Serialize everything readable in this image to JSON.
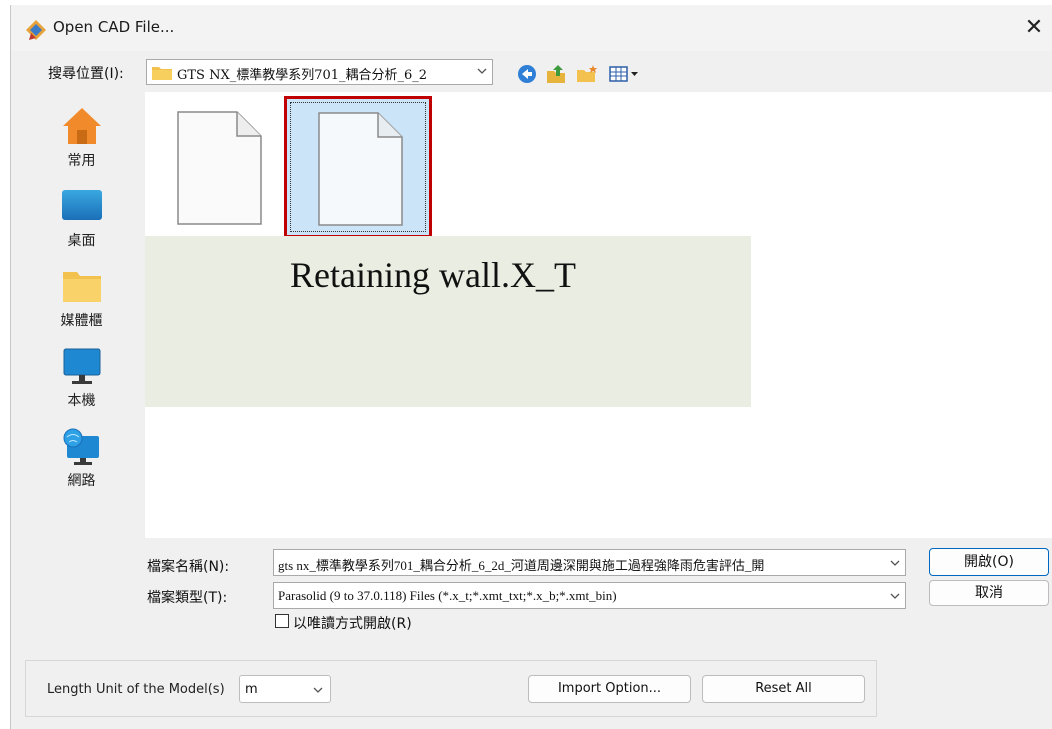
{
  "window": {
    "title": "Open CAD File...",
    "close_glyph": "✕"
  },
  "toolbar": {
    "look_in_label": "搜尋位置(I):",
    "look_in_value": "GTS NX_標準教學系列701_耦合分析_6_2",
    "icons": [
      "back-icon",
      "up-folder-icon",
      "new-folder-icon",
      "view-menu-icon"
    ]
  },
  "places": [
    {
      "label": "常用",
      "icon": "home-icon"
    },
    {
      "label": "桌面",
      "icon": "desktop-icon"
    },
    {
      "label": "媒體櫃",
      "icon": "library-folder-icon"
    },
    {
      "label": "本機",
      "icon": "computer-icon"
    },
    {
      "label": "網路",
      "icon": "network-icon"
    }
  ],
  "files": {
    "overlay_caption": "Retaining wall.X_T"
  },
  "form": {
    "filename_label": "檔案名稱(N):",
    "filename_value": "gts nx_標準教學系列701_耦合分析_6_2d_河道周邊深開與施工過程強降雨危害評估_開",
    "filetype_label": "檔案類型(T):",
    "filetype_value": "Parasolid (9 to 37.0.118) Files (*.x_t;*.xmt_txt;*.x_b;*.xmt_bin)",
    "readonly_label": "以唯讀方式開啟(R)",
    "readonly_checked": false,
    "open_button": "開啟(O)",
    "cancel_button": "取消"
  },
  "options": {
    "unit_label": "Length Unit of the Model(s)",
    "unit_value": "m",
    "import_option_button": "Import Option...",
    "reset_all_button": "Reset All"
  },
  "colors": {
    "selection": "#cce4f7",
    "selection_border": "#c00000",
    "accent": "#0067c0",
    "caption_bg": "#eaede1"
  }
}
